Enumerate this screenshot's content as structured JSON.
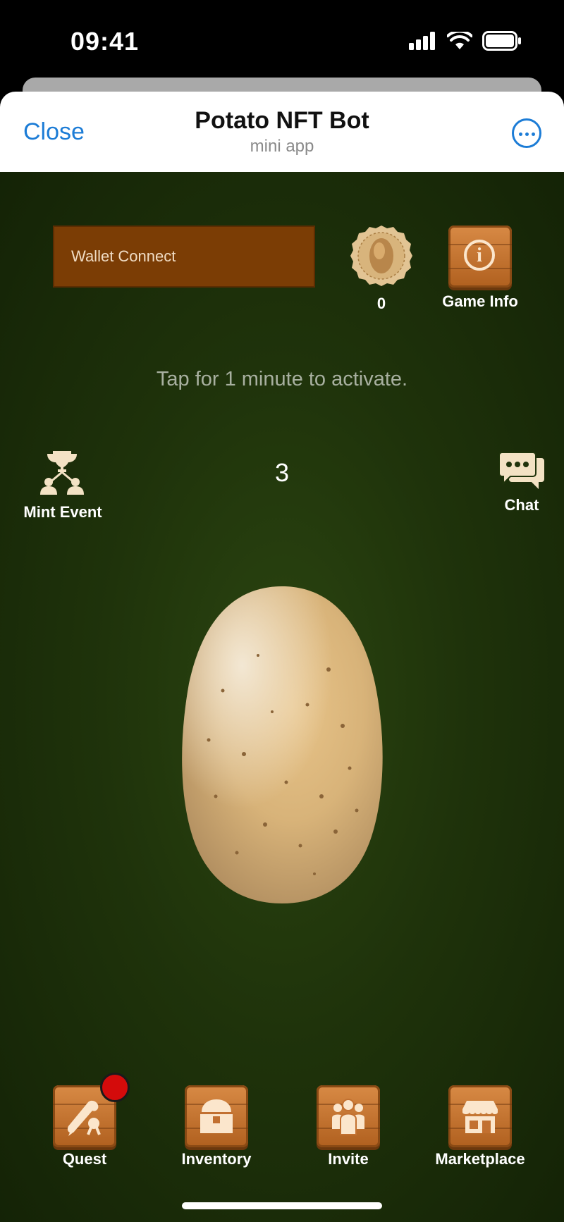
{
  "status": {
    "time": "09:41"
  },
  "header": {
    "close_label": "Close",
    "title": "Potato NFT Bot",
    "subtitle": "mini app"
  },
  "wallet": {
    "label": "Wallet Connect"
  },
  "coin": {
    "count": "0"
  },
  "game_info": {
    "label": "Game Info"
  },
  "hint": "Tap for 1 minute to activate.",
  "counter": "3",
  "mint_event": {
    "label": "Mint Event"
  },
  "chat": {
    "label": "Chat"
  },
  "bottom_nav": [
    {
      "label": "Quest",
      "icon": "scroll-icon",
      "notification": true
    },
    {
      "label": "Inventory",
      "icon": "treasure-chest-icon"
    },
    {
      "label": "Invite",
      "icon": "people-icon"
    },
    {
      "label": "Marketplace",
      "icon": "shop-icon"
    }
  ],
  "colors": {
    "accent": "#1c7cd6",
    "game_bg": "#1f330b",
    "wallet_bg": "#7b3d05",
    "wood": "#c87534",
    "badge": "#d40b0b"
  }
}
